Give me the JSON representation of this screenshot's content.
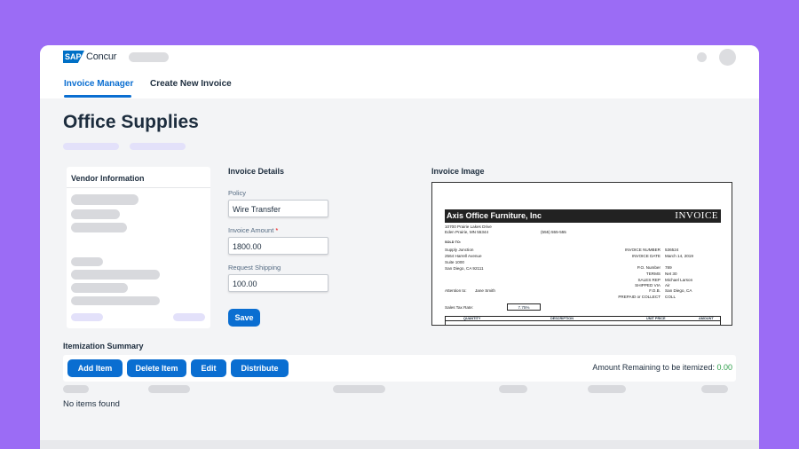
{
  "app": {
    "brand_badge": "SAP",
    "brand_name": "Concur"
  },
  "tabs": [
    {
      "label": "Invoice Manager",
      "active": true
    },
    {
      "label": "Create New Invoice",
      "active": false
    }
  ],
  "page": {
    "title": "Office Supplies"
  },
  "vendor": {
    "title": "Vendor Information"
  },
  "details": {
    "title": "Invoice Details",
    "policy_label": "Policy",
    "policy_value": "Wire Transfer",
    "amount_label": "Invoice Amount",
    "amount_required": "*",
    "amount_value": "1800.00",
    "shipping_label": "Request Shipping",
    "shipping_value": "100.00",
    "save_label": "Save"
  },
  "invoice_image": {
    "title": "Invoice Image",
    "company": "Axis Office Furniture, Inc",
    "doc_type": "INVOICE",
    "address_line1": "10700 Prairie Lakes Drive",
    "address_line2": "Eden Prairie, MN 55344",
    "phone": "(555) 555-555",
    "sold_to_label": "SOLD TO:",
    "sold_to": [
      "Supply Junction",
      "2564 Harrell Avenue",
      "Suite 1000",
      "San Diego, CA  92111"
    ],
    "attention_label": "Attention to:",
    "attention_name": "Jane Smith",
    "meta_labels": [
      "INVOICE NUMBER",
      "INVOICE DATE",
      "",
      "P.O. Number",
      "TERMS",
      "SALES REP",
      "SHIPPED VIA",
      "F.O.B.",
      "PREPAID or COLLECT"
    ],
    "meta_values": [
      "536524",
      "March 14, 2019",
      "",
      "789",
      "Net 30",
      "Michael Larson",
      "Air",
      "San Diego, CA",
      "COLL"
    ],
    "sales_tax_label": "Sales Tax Rate:",
    "sales_tax_value": "7.75%",
    "columns": [
      "QUANTITY",
      "DESCRIPTION",
      "UNIT PRICE",
      "AMOUNT"
    ]
  },
  "itemization": {
    "title": "Itemization Summary",
    "buttons": [
      "Add Item",
      "Delete Item",
      "Edit",
      "Distribute"
    ],
    "remaining_label": "Amount Remaining to be itemized:",
    "remaining_value": "0.00",
    "empty_text": "No items found"
  },
  "colors": {
    "accent": "#0a6ed1",
    "background": "#9b6cf5",
    "success": "#2b9e48"
  }
}
